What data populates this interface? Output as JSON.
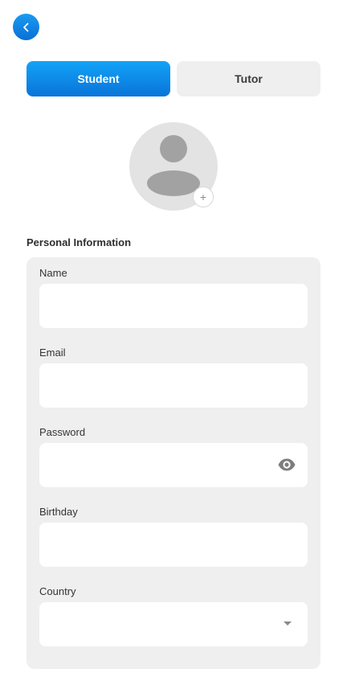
{
  "header": {
    "back_icon": "chevron-left-icon"
  },
  "role_tabs": {
    "student_label": "Student",
    "tutor_label": "Tutor",
    "selected": "Student",
    "active_color": "#0a85e6"
  },
  "avatar": {
    "placeholder_icon": "user-silhouette-icon",
    "add_icon_glyph": "+"
  },
  "form": {
    "section_title": "Personal Information",
    "fields": {
      "name": {
        "label": "Name",
        "value": ""
      },
      "email": {
        "label": "Email",
        "value": ""
      },
      "password": {
        "label": "Password",
        "value": "",
        "toggle_icon": "eye-icon"
      },
      "birthday": {
        "label": "Birthday",
        "value": ""
      },
      "country": {
        "label": "Country",
        "value": "",
        "dropdown_icon": "caret-down-icon"
      }
    }
  }
}
